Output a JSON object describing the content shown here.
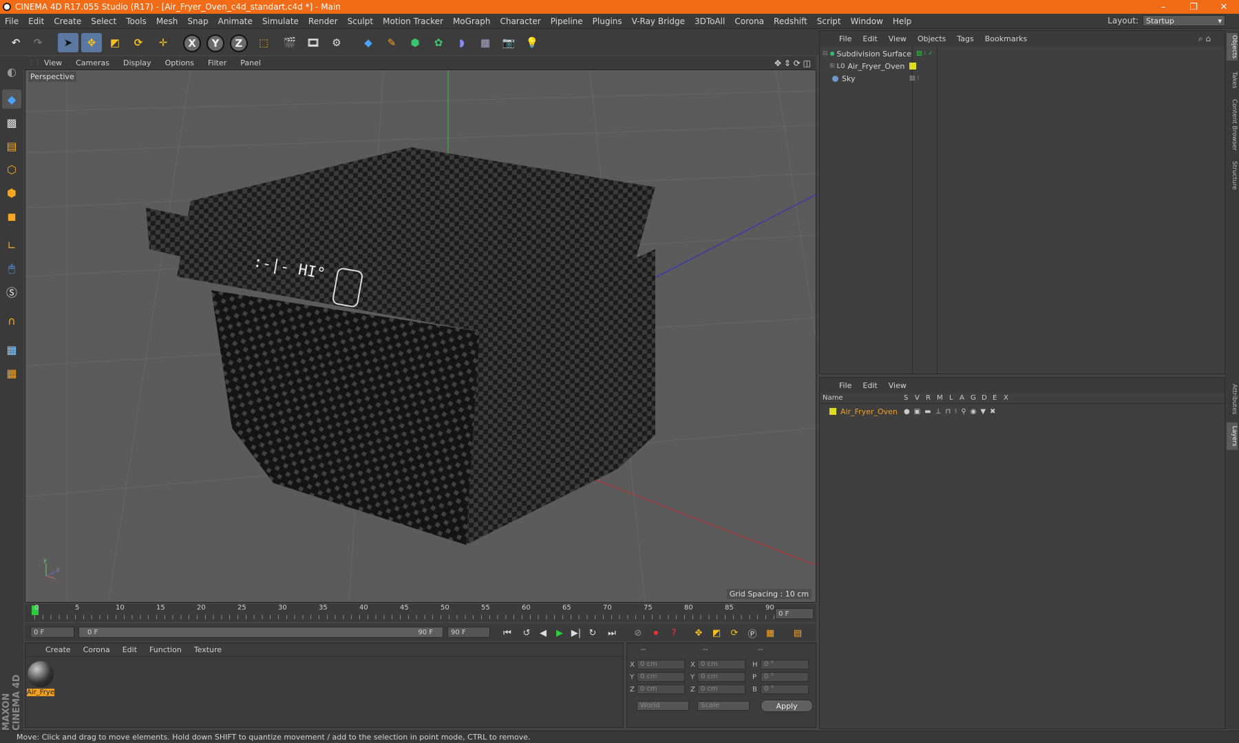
{
  "window": {
    "title": "CINEMA 4D R17.055 Studio (R17) - [Air_Fryer_Oven_c4d_standart.c4d *] - Main",
    "minimize": "–",
    "restore": "❐",
    "close": "✕"
  },
  "menu": [
    "File",
    "Edit",
    "Create",
    "Select",
    "Tools",
    "Mesh",
    "Snap",
    "Animate",
    "Simulate",
    "Render",
    "Sculpt",
    "Motion Tracker",
    "MoGraph",
    "Character",
    "Pipeline",
    "Plugins",
    "V-Ray Bridge",
    "3DToAll",
    "Corona",
    "Redshift",
    "Script",
    "Window",
    "Help"
  ],
  "layout": {
    "label": "Layout:",
    "value": "Startup"
  },
  "viewport": {
    "menu": [
      "View",
      "Cameras",
      "Display",
      "Options",
      "Filter",
      "Panel"
    ],
    "camera": "Perspective",
    "grid_spacing": "Grid Spacing : 10 cm"
  },
  "timeline": {
    "ticks": [
      "0",
      "5",
      "10",
      "15",
      "20",
      "25",
      "30",
      "35",
      "40",
      "45",
      "50",
      "55",
      "60",
      "65",
      "70",
      "75",
      "80",
      "85",
      "90"
    ],
    "current_frame": "0 F",
    "start_field": "0 F",
    "range_start": "0 F",
    "range_end": "90 F",
    "end_field": "90 F"
  },
  "materials": {
    "menu": [
      "Create",
      "Corona",
      "Edit",
      "Function",
      "Texture"
    ],
    "items": [
      {
        "name": "Air_Frye"
      }
    ]
  },
  "coords": {
    "headers": [
      "--",
      "--",
      "--"
    ],
    "rows": [
      {
        "a": "X",
        "v1": "0 cm",
        "b": "X",
        "v2": "0 cm",
        "c": "H",
        "v3": "0 °"
      },
      {
        "a": "Y",
        "v1": "0 cm",
        "b": "Y",
        "v2": "0 cm",
        "c": "P",
        "v3": "0 °"
      },
      {
        "a": "Z",
        "v1": "0 cm",
        "b": "Z",
        "v2": "0 cm",
        "c": "B",
        "v3": "0 °"
      }
    ],
    "mode1": "World",
    "mode2": "Scale",
    "apply": "Apply"
  },
  "objects": {
    "menu": [
      "File",
      "Edit",
      "View",
      "Objects",
      "Tags",
      "Bookmarks"
    ],
    "items": [
      {
        "name": "Subdivision Surface",
        "color": "#2fbf6a"
      },
      {
        "name": "Air_Fryer_Oven",
        "color": "#dddd22"
      },
      {
        "name": "Sky",
        "color": "#6a9ad0"
      }
    ]
  },
  "layers": {
    "menu": [
      "File",
      "Edit",
      "View"
    ],
    "columns": [
      "Name",
      "S",
      "V",
      "R",
      "M",
      "L",
      "A",
      "G",
      "D",
      "E",
      "X"
    ],
    "items": [
      {
        "name": "Air_Fryer_Oven",
        "color": "#f0a020"
      }
    ]
  },
  "right_tabs": [
    "Objects",
    "Takes",
    "Content Browser",
    "Structure",
    "Attributes",
    "Layers"
  ],
  "status": "Move: Click and drag to move elements. Hold down SHIFT to quantize movement / add to the selection in point mode, CTRL to remove.",
  "brand": "MAXON CINEMA 4D"
}
